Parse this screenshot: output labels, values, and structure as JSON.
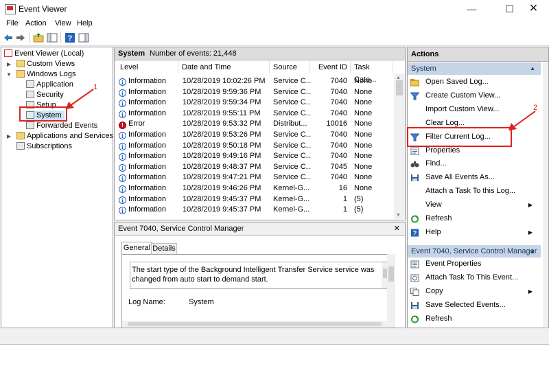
{
  "window": {
    "title": "Event Viewer"
  },
  "menu": [
    "File",
    "Action",
    "View",
    "Help"
  ],
  "tree": {
    "root": "Event Viewer (Local)",
    "custom_views": "Custom Views",
    "windows_logs": "Windows Logs",
    "application": "Application",
    "security": "Security",
    "setup": "Setup",
    "system": "System",
    "forwarded_events": "Forwarded Events",
    "apps_services": "Applications and Services Lo",
    "subscriptions": "Subscriptions"
  },
  "center": {
    "log_name": "System",
    "event_count": "Number of events: 21,448",
    "columns": [
      "Level",
      "Date and Time",
      "Source",
      "Event ID",
      "Task Cate..."
    ],
    "events": [
      {
        "level": "Information",
        "icon": "info",
        "date": "10/28/2019 10:02:26 PM",
        "source": "Service C...",
        "id": "7040",
        "task": "None"
      },
      {
        "level": "Information",
        "icon": "info",
        "date": "10/28/2019 9:59:36 PM",
        "source": "Service C...",
        "id": "7040",
        "task": "None"
      },
      {
        "level": "Information",
        "icon": "info",
        "date": "10/28/2019 9:59:34 PM",
        "source": "Service C...",
        "id": "7040",
        "task": "None"
      },
      {
        "level": "Information",
        "icon": "info",
        "date": "10/28/2019 9:55:11 PM",
        "source": "Service C...",
        "id": "7040",
        "task": "None"
      },
      {
        "level": "Error",
        "icon": "error",
        "date": "10/28/2019 9:53:32 PM",
        "source": "Distribut...",
        "id": "10016",
        "task": "None"
      },
      {
        "level": "Information",
        "icon": "info",
        "date": "10/28/2019 9:53:26 PM",
        "source": "Service C...",
        "id": "7040",
        "task": "None"
      },
      {
        "level": "Information",
        "icon": "info",
        "date": "10/28/2019 9:50:18 PM",
        "source": "Service C...",
        "id": "7040",
        "task": "None"
      },
      {
        "level": "Information",
        "icon": "info",
        "date": "10/28/2019 9:49:16 PM",
        "source": "Service C...",
        "id": "7040",
        "task": "None"
      },
      {
        "level": "Information",
        "icon": "info",
        "date": "10/28/2019 9:48:37 PM",
        "source": "Service C...",
        "id": "7045",
        "task": "None"
      },
      {
        "level": "Information",
        "icon": "info",
        "date": "10/28/2019 9:47:21 PM",
        "source": "Service C...",
        "id": "7040",
        "task": "None"
      },
      {
        "level": "Information",
        "icon": "info",
        "date": "10/28/2019 9:46:26 PM",
        "source": "Kernel-G...",
        "id": "16",
        "task": "None"
      },
      {
        "level": "Information",
        "icon": "info",
        "date": "10/28/2019 9:45:37 PM",
        "source": "Kernel-G...",
        "id": "1",
        "task": "(5)"
      },
      {
        "level": "Information",
        "icon": "info",
        "date": "10/28/2019 9:45:37 PM",
        "source": "Kernel-G...",
        "id": "1",
        "task": "(5)"
      }
    ],
    "detail_title": "Event 7040, Service Control Manager",
    "tabs": [
      "General",
      "Details"
    ],
    "detail_text": "The start type of the Background Intelligent Transfer Service service was changed from auto start to demand start.",
    "log_name_label": "Log Name:",
    "log_name_value": "System"
  },
  "actions": {
    "header": "Actions",
    "section1": "System",
    "items1": [
      {
        "label": "Open Saved Log...",
        "icon": "folder-icon"
      },
      {
        "label": "Create Custom View...",
        "icon": "funnel-icon"
      },
      {
        "label": "Import Custom View...",
        "icon": "none"
      },
      {
        "label": "Clear Log...",
        "icon": "none"
      },
      {
        "label": "Filter Current Log...",
        "icon": "funnel-icon"
      },
      {
        "label": "Properties",
        "icon": "properties-icon"
      },
      {
        "label": "Find...",
        "icon": "binoculars-icon"
      },
      {
        "label": "Save All Events As...",
        "icon": "save-icon"
      },
      {
        "label": "Attach a Task To this Log...",
        "icon": "none"
      },
      {
        "label": "View",
        "icon": "none",
        "submenu": "▶"
      },
      {
        "label": "Refresh",
        "icon": "refresh-icon"
      },
      {
        "label": "Help",
        "icon": "help-icon",
        "submenu": "▶"
      }
    ],
    "section2": "Event 7040, Service Control Manager",
    "items2": [
      {
        "label": "Event Properties",
        "icon": "properties-icon"
      },
      {
        "label": "Attach Task To This Event...",
        "icon": "task-icon"
      },
      {
        "label": "Copy",
        "icon": "copy-icon",
        "submenu": "▶"
      },
      {
        "label": "Save Selected Events...",
        "icon": "save-icon"
      },
      {
        "label": "Refresh",
        "icon": "refresh-icon"
      }
    ]
  },
  "annotations": {
    "one": "1",
    "two": "2"
  }
}
